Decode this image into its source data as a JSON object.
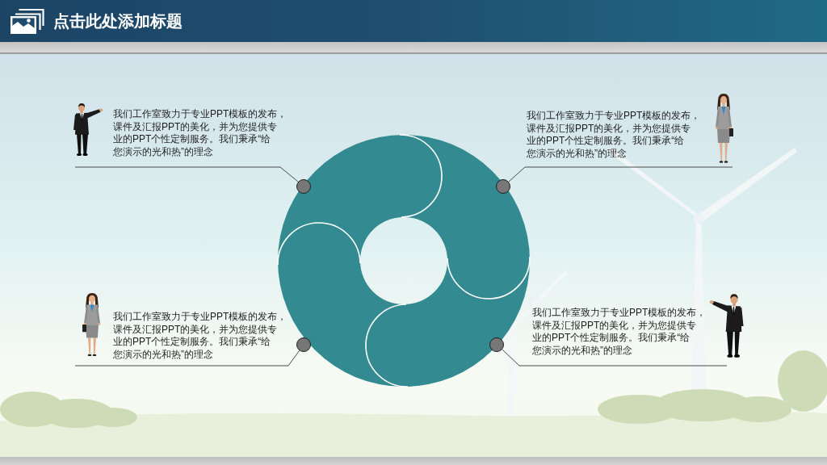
{
  "slide": {
    "title": "点击此处添加标题"
  },
  "callouts": [
    {
      "kind": "man",
      "lines": [
        "我们工作室致力于专业PPT模板的发布，",
        "课件及汇报PPT的美化，并为您提供专",
        "业的PPT个性定制服务。我们秉承“给",
        "您演示的光和热”的理念"
      ]
    },
    {
      "kind": "woman",
      "lines": [
        "我们工作室致力于专业PPT模板的发布，",
        "课件及汇报PPT的美化，并为您提供专",
        "业的PPT个性定制服务。我们秉承“给",
        "您演示的光和热”的理念"
      ]
    },
    {
      "kind": "woman",
      "lines": [
        "我们工作室致力于专业PPT模板的发布，",
        "课件及汇报PPT的美化，并为您提供专",
        "业的PPT个性定制服务。我们秉承“给",
        "您演示的光和热”的理念"
      ]
    },
    {
      "kind": "man",
      "lines": [
        "我们工作室致力于专业PPT模板的发布，",
        "课件及汇报PPT的美化，并为您提供专",
        "业的PPT个性定制服务。我们秉承“给",
        "您演示的光和热”的理念"
      ]
    }
  ]
}
